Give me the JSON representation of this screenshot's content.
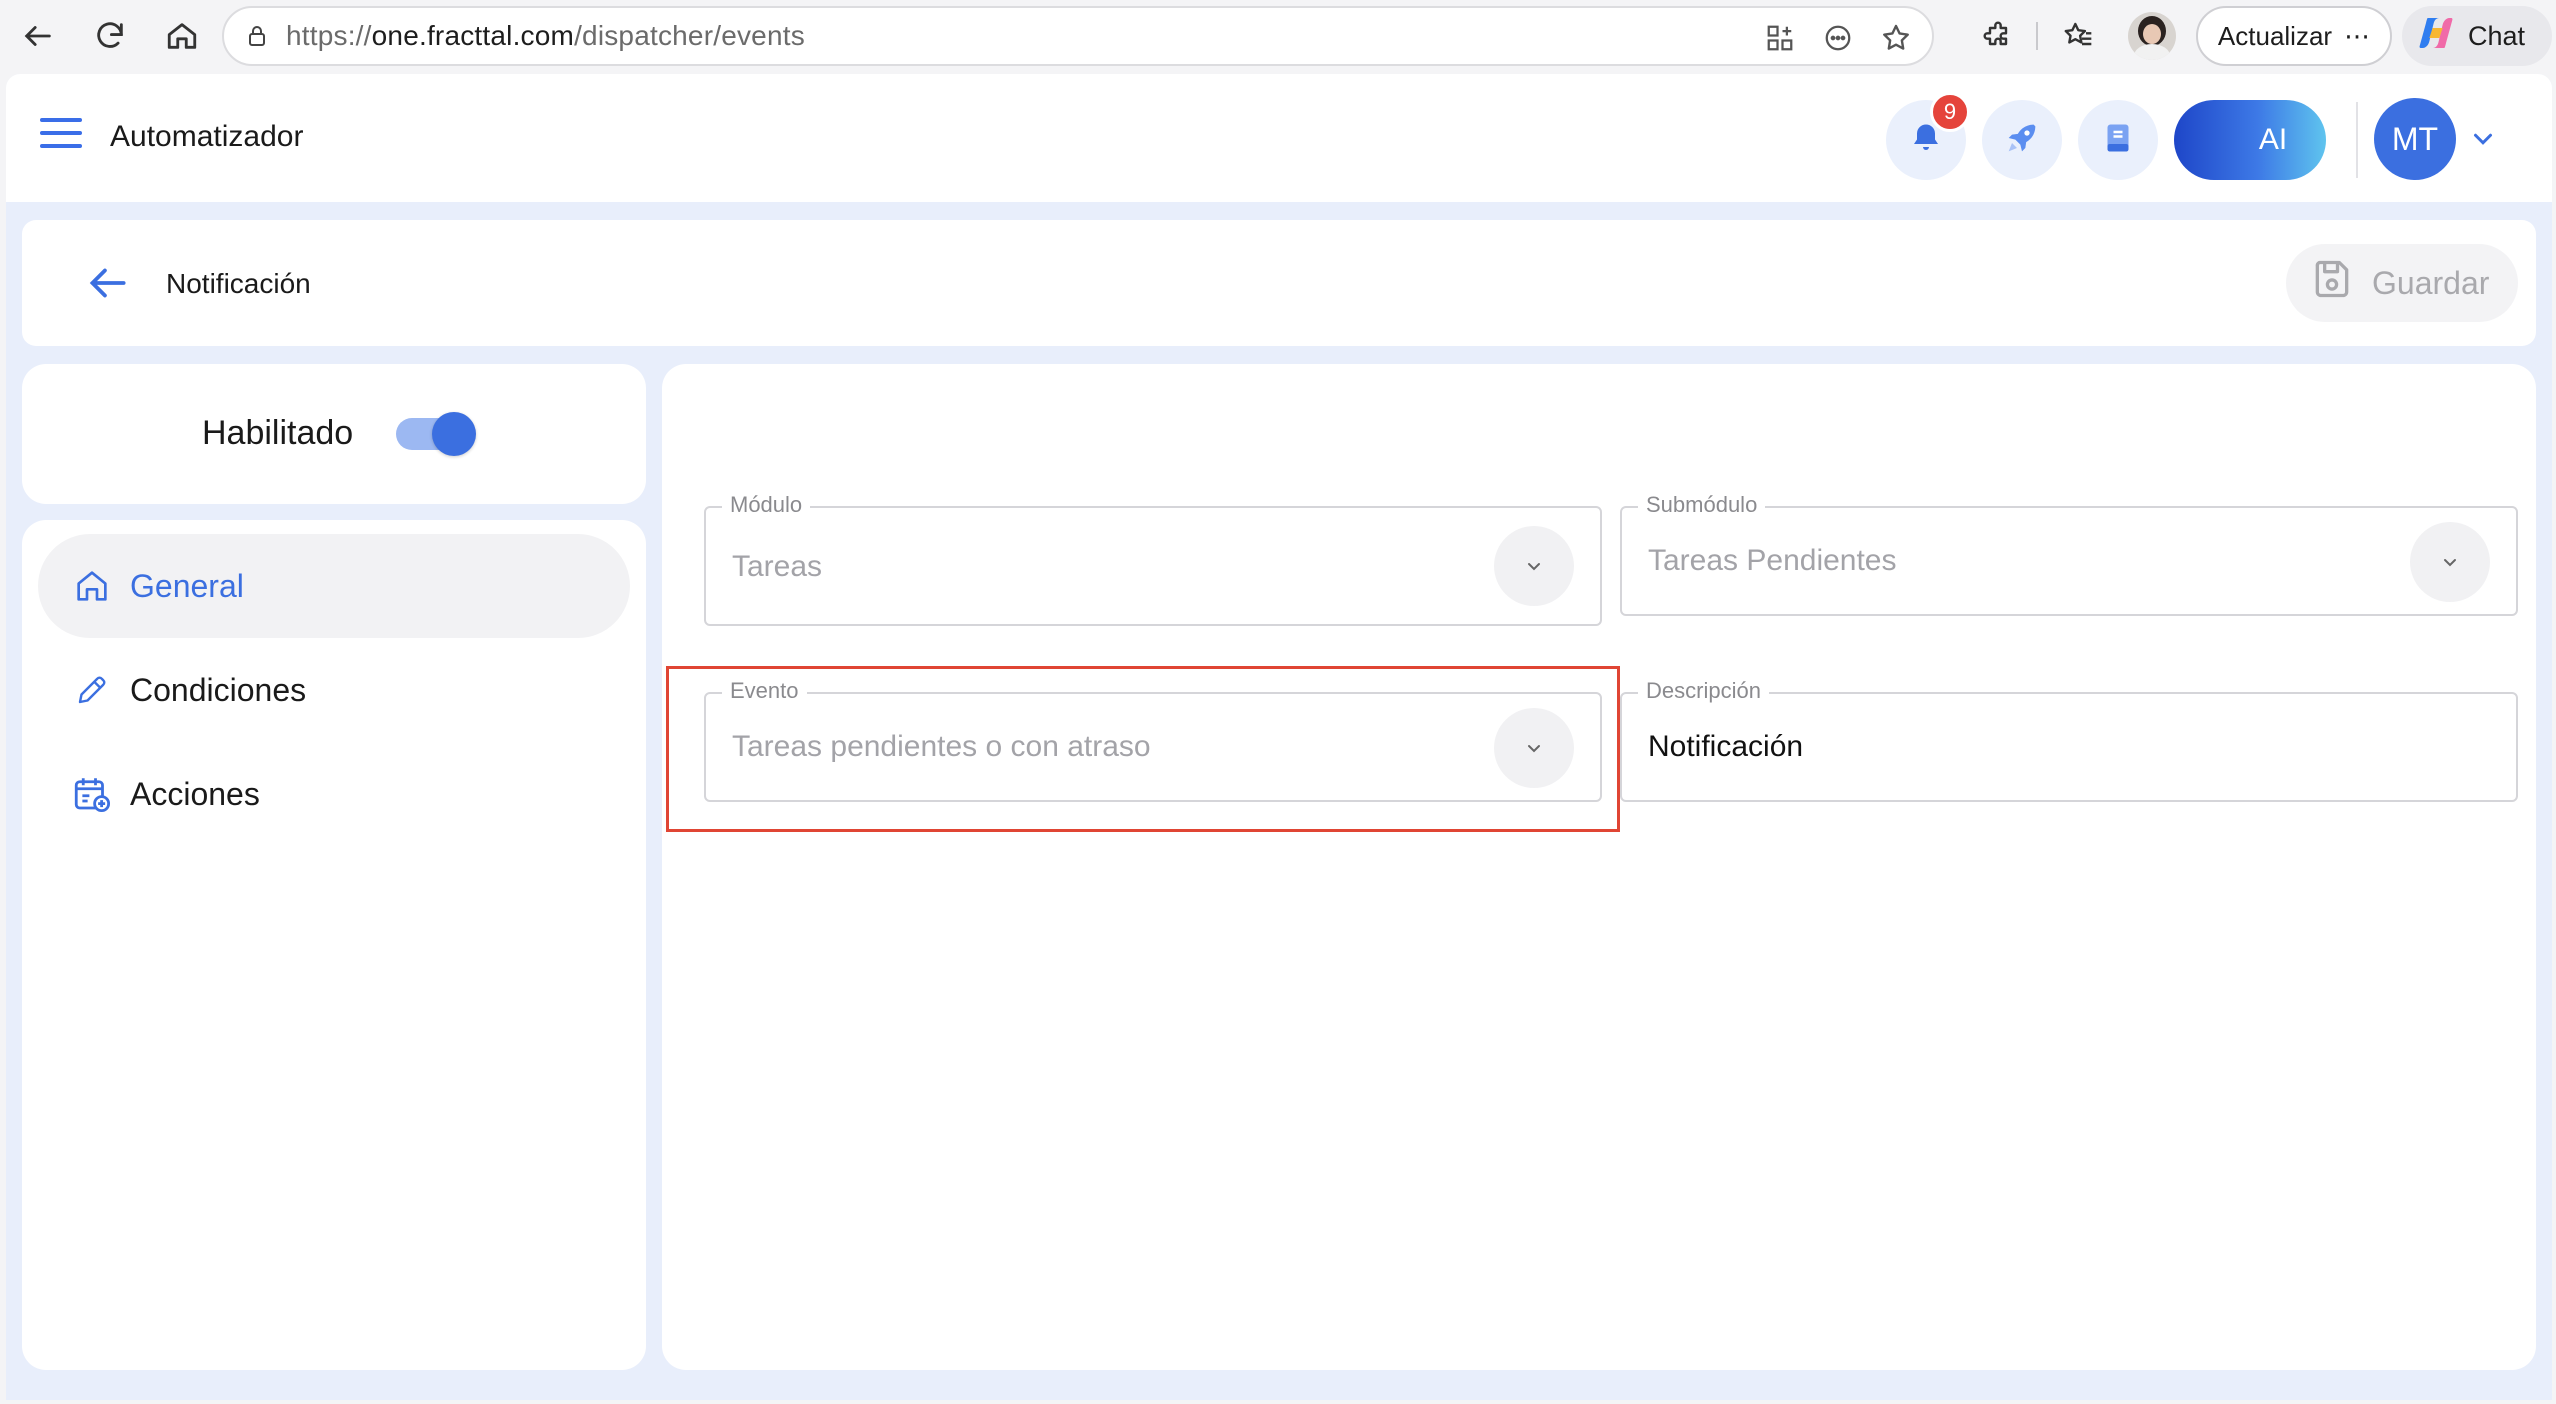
{
  "browser": {
    "url_prefix": "https://",
    "url_host": "one.fracttal.com",
    "url_path": "/dispatcher/events",
    "update_label": "Actualizar",
    "update_more": "⋯",
    "chat_label": "Chat"
  },
  "app": {
    "title": "Automatizador",
    "notification_count": "9",
    "ai_label": "AI",
    "avatar_initials": "MT"
  },
  "header": {
    "title": "Notificación",
    "save_label": "Guardar"
  },
  "enabled": {
    "label": "Habilitado",
    "on": true
  },
  "sidebar": {
    "items": [
      {
        "label": "General",
        "icon": "home-icon",
        "active": true
      },
      {
        "label": "Condiciones",
        "icon": "pencil-icon",
        "active": false
      },
      {
        "label": "Acciones",
        "icon": "calendar-add-icon",
        "active": false
      }
    ]
  },
  "form": {
    "modulo": {
      "label": "Módulo",
      "value": "Tareas"
    },
    "submodulo": {
      "label": "Submódulo",
      "value": "Tareas Pendientes"
    },
    "evento": {
      "label": "Evento",
      "value": "Tareas pendientes o con atraso"
    },
    "descripcion": {
      "label": "Descripción",
      "value": "Notificación"
    }
  },
  "colors": {
    "accent": "#3b6fe0",
    "highlight": "#e04534",
    "badge": "#e5443b"
  }
}
